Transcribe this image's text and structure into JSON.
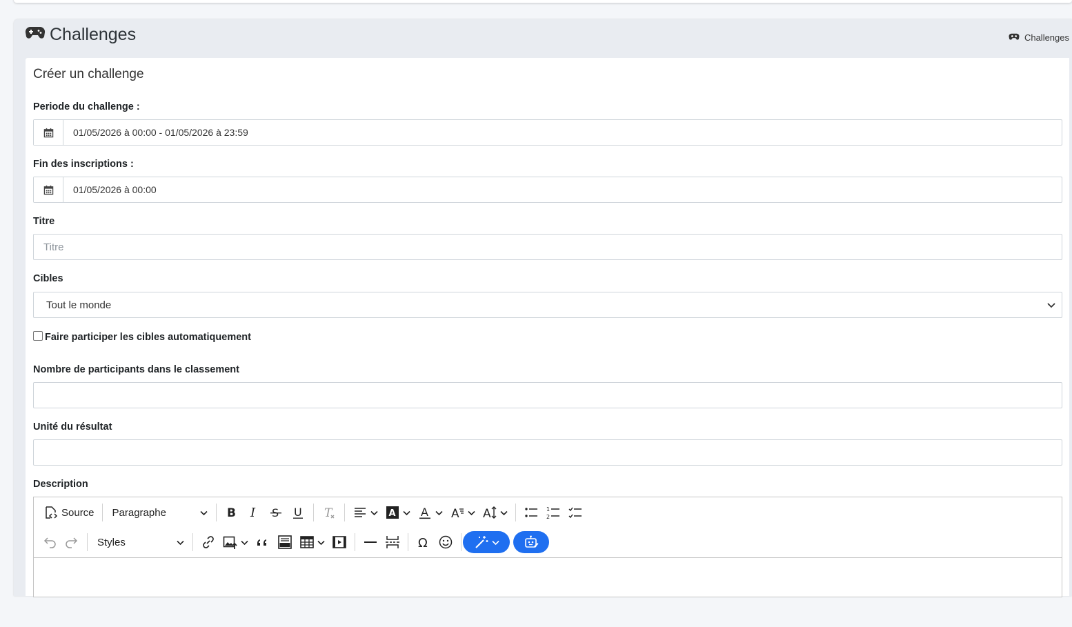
{
  "header": {
    "title": "Challenges",
    "title_icon": "gamepad-icon",
    "breadcrumb_label": "Challenges",
    "breadcrumb_icon": "gamepad-icon"
  },
  "form": {
    "section_title": "Créer un challenge",
    "period": {
      "label": "Periode du challenge :",
      "value": "01/05/2026 à 00:00 - 01/05/2026 à 23:59",
      "icon": "calendar-icon"
    },
    "registration_end": {
      "label": "Fin des inscriptions :",
      "value": "01/05/2026 à 00:00",
      "icon": "calendar-icon"
    },
    "title_field": {
      "label": "Titre",
      "placeholder": "Titre",
      "value": ""
    },
    "targets": {
      "label": "Cibles",
      "selected": "Tout le monde"
    },
    "auto_participate": {
      "label": "Faire participer les cibles automatiquement",
      "checked": false
    },
    "ranking_count": {
      "label": "Nombre de participants dans le classement",
      "value": ""
    },
    "result_unit": {
      "label": "Unité du résultat",
      "value": ""
    },
    "description": {
      "label": "Description"
    }
  },
  "editor_toolbar": {
    "source_label": "Source",
    "paragraph_label": "Paragraphe",
    "styles_label": "Styles",
    "accent_color": "#1f6ff0"
  }
}
